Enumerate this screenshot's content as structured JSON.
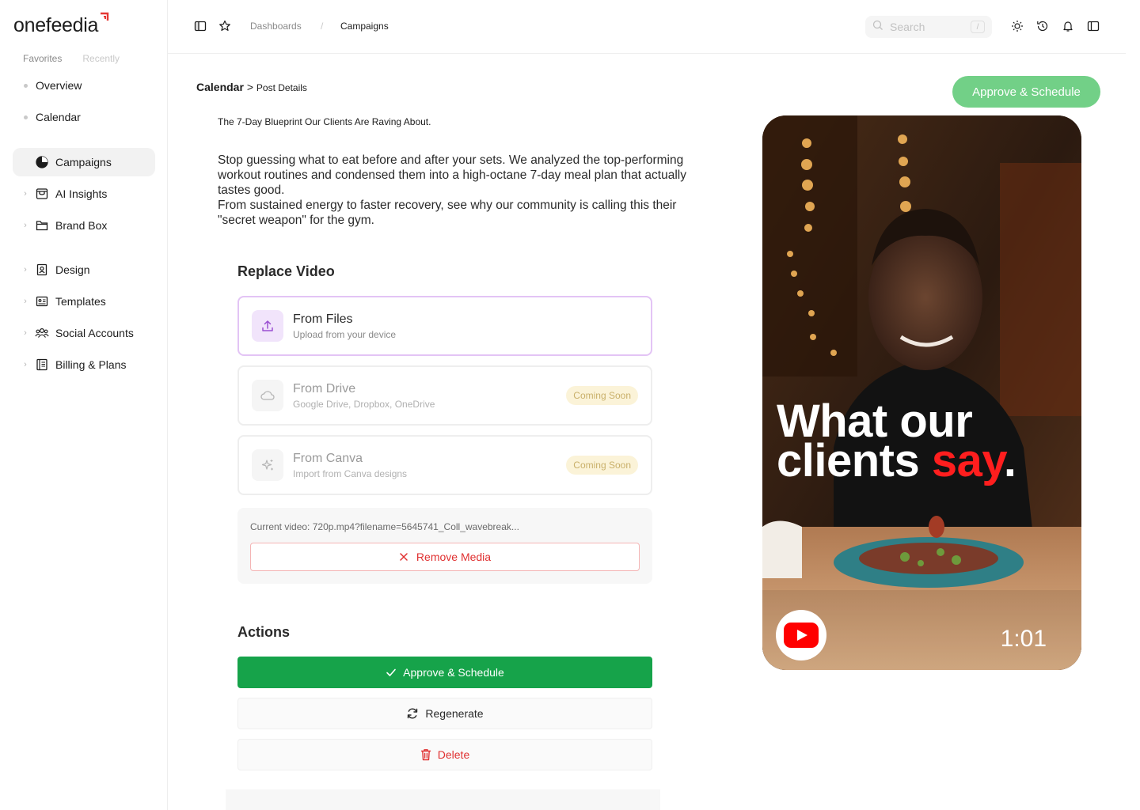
{
  "brand": {
    "name": "onefeedia",
    "accent": "#e53935"
  },
  "sidebar": {
    "tabs": [
      "Favorites",
      "Recently"
    ],
    "favorites": [
      {
        "label": "Overview"
      },
      {
        "label": "Calendar"
      }
    ],
    "items": [
      {
        "label": "Campaigns",
        "icon": "pie-chart-icon",
        "active": true
      },
      {
        "label": "AI Insights",
        "icon": "inbox-icon"
      },
      {
        "label": "Brand Box",
        "icon": "folder-icon"
      },
      {
        "label": "Design",
        "icon": "id-badge-icon"
      },
      {
        "label": "Templates",
        "icon": "id-card-icon"
      },
      {
        "label": "Social Accounts",
        "icon": "users-icon"
      },
      {
        "label": "Billing & Plans",
        "icon": "book-icon"
      }
    ]
  },
  "topbar": {
    "breadcrumb": [
      "Dashboards",
      "/",
      "Campaigns"
    ],
    "search": {
      "placeholder": "Search",
      "shortcut": "/"
    },
    "icons": [
      "sidebar-toggle-icon",
      "star-icon",
      "sun-icon",
      "history-icon",
      "bell-icon",
      "panel-icon"
    ]
  },
  "page": {
    "breadcrumb_parent": "Calendar",
    "breadcrumb_sep": ">",
    "breadcrumb_current": "Post Details",
    "approve_label": "Approve & Schedule",
    "post_title": "The 7-Day Blueprint Our Clients Are Raving About.",
    "post_body_1": "Stop guessing what to eat before and after your sets. We analyzed the top-performing workout routines and condensed them into a high-octane 7-day meal plan that actually tastes good.",
    "post_body_2": "From sustained energy to faster recovery, see why our community is calling this their \"secret weapon\" for the gym."
  },
  "replace_video": {
    "title": "Replace Video",
    "options": [
      {
        "name": "From Files",
        "desc": "Upload from your device",
        "icon": "upload-icon",
        "selected": true
      },
      {
        "name": "From Drive",
        "desc": "Google Drive, Dropbox, OneDrive",
        "icon": "cloud-icon",
        "badge": "Coming Soon"
      },
      {
        "name": "From Canva",
        "desc": "Import from Canva designs",
        "icon": "sparkle-icon",
        "badge": "Coming Soon"
      }
    ],
    "current_label": "Current video:",
    "current_value": "720p.mp4?filename=5645741_Coll_wavebreak...",
    "remove_label": "Remove Media"
  },
  "actions": {
    "title": "Actions",
    "approve": "Approve & Schedule",
    "regenerate": "Regenerate",
    "delete": "Delete"
  },
  "preview": {
    "caption_line1": "What our",
    "caption_line2a": "clients ",
    "caption_line2b": "say",
    "caption_line2c": ".",
    "duration": "1:01",
    "platform_icon": "youtube-icon"
  },
  "colors": {
    "approve_green": "#16a34a",
    "approve_light": "#72d087",
    "danger": "#e03131",
    "highlight_red": "#ff1e1e"
  }
}
